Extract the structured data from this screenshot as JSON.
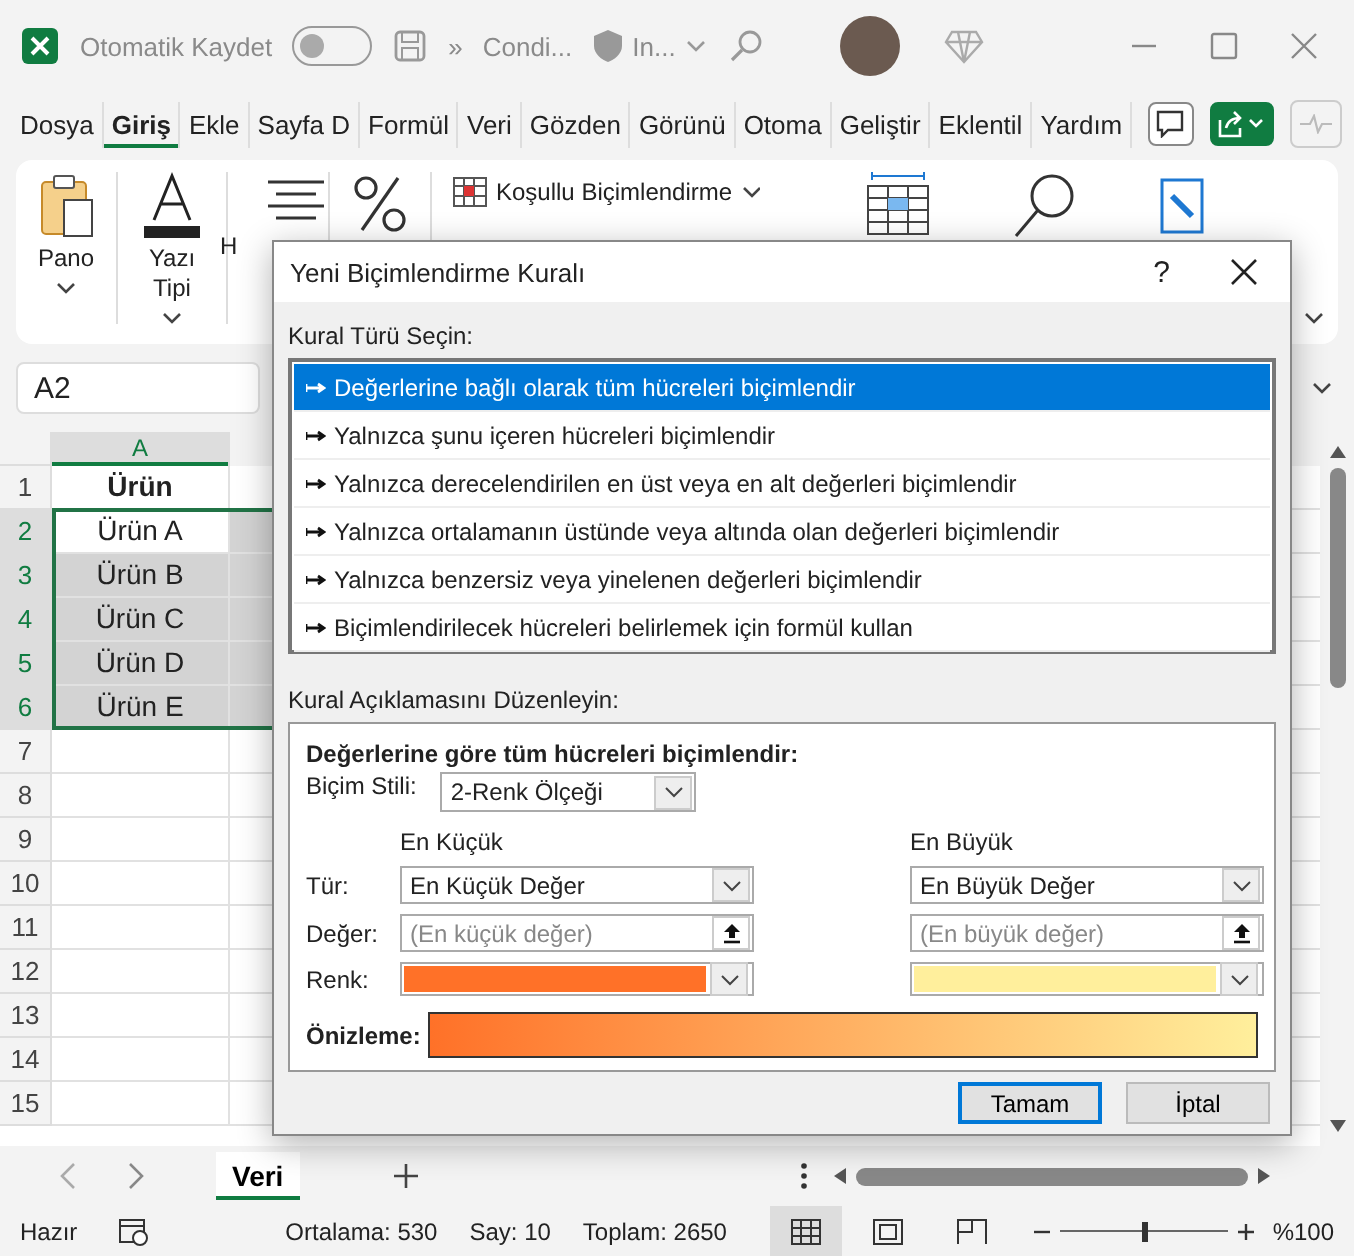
{
  "title_bar": {
    "autosave_label": "Otomatik Kaydet",
    "autosave_on": false,
    "more": "»",
    "document": "Condi...",
    "sensitivity": "In..."
  },
  "menu_tabs": [
    {
      "label": "Dosya",
      "selected": false
    },
    {
      "label": "Giriş",
      "selected": true
    },
    {
      "label": "Ekle",
      "selected": false
    },
    {
      "label": "Sayfa D",
      "selected": false
    },
    {
      "label": "Formül",
      "selected": false
    },
    {
      "label": "Veri",
      "selected": false
    },
    {
      "label": "Gözden",
      "selected": false
    },
    {
      "label": "Görünü",
      "selected": false
    },
    {
      "label": "Otoma",
      "selected": false
    },
    {
      "label": "Geliştir",
      "selected": false
    },
    {
      "label": "Eklentil",
      "selected": false
    },
    {
      "label": "Yardım",
      "selected": false
    }
  ],
  "ribbon": {
    "groups": [
      {
        "kind": "clipboard",
        "label": "Pano"
      },
      {
        "kind": "font",
        "label": "Yazı Tipi"
      },
      {
        "kind": "alignment",
        "label": "H"
      },
      {
        "kind": "number"
      }
    ],
    "conditional_formatting": "Koşullu Biçimlendirme"
  },
  "name_box": "A2",
  "sheet": {
    "columns": [
      "A"
    ],
    "rows": [
      {
        "header": "1",
        "value": "Ürün",
        "kind": "header",
        "selected": false,
        "active": false
      },
      {
        "header": "2",
        "value": "Ürün A",
        "kind": "data",
        "selected": true,
        "active": true
      },
      {
        "header": "3",
        "value": "Ürün B",
        "kind": "data",
        "selected": true,
        "active": false
      },
      {
        "header": "4",
        "value": "Ürün C",
        "kind": "data",
        "selected": true,
        "active": false
      },
      {
        "header": "5",
        "value": "Ürün D",
        "kind": "data",
        "selected": true,
        "active": false
      },
      {
        "header": "6",
        "value": "Ürün E",
        "kind": "data",
        "selected": true,
        "active": false
      },
      {
        "header": "7",
        "selected": false,
        "active": false
      },
      {
        "header": "8",
        "selected": false,
        "active": false
      },
      {
        "header": "9",
        "selected": false,
        "active": false
      },
      {
        "header": "10",
        "selected": false,
        "active": false
      },
      {
        "header": "11",
        "selected": false,
        "active": false
      },
      {
        "header": "12",
        "selected": false,
        "active": false
      },
      {
        "header": "13",
        "selected": false,
        "active": false
      },
      {
        "header": "14",
        "selected": false,
        "active": false
      },
      {
        "header": "15",
        "selected": false,
        "active": false
      }
    ]
  },
  "sheet_tabs": [
    {
      "label": "Veri",
      "selected": true
    }
  ],
  "status_bar": {
    "mode": "Hazır",
    "average": "Ortalama: 530",
    "count": "Say: 10",
    "sum": "Toplam: 2650",
    "zoom": "%100",
    "zoom_slider": {
      "level": 0.5
    },
    "views": [
      {
        "kind": "normal",
        "selected": true
      },
      {
        "kind": "page_layout",
        "selected": false
      },
      {
        "kind": "page_break",
        "selected": false
      }
    ]
  },
  "dialog": {
    "title": "Yeni Biçimlendirme Kuralı",
    "help": "?",
    "rule_type_label": "Kural Türü Seçin:",
    "rules": [
      {
        "label": "Değerlerine bağlı olarak tüm hücreleri biçimlendir",
        "selected": true
      },
      {
        "label": "Yalnızca şunu içeren hücreleri biçimlendir",
        "selected": false
      },
      {
        "label": "Yalnızca derecelendirilen en üst veya en alt değerleri biçimlendir",
        "selected": false
      },
      {
        "label": "Yalnızca ortalamanın üstünde veya altında olan değerleri biçimlendir",
        "selected": false
      },
      {
        "label": "Yalnızca benzersiz veya yinelenen değerleri biçimlendir",
        "selected": false
      },
      {
        "label": "Biçimlendirilecek hücreleri belirlemek için formül kullan",
        "selected": false
      }
    ],
    "description_label": "Kural Açıklamasını Düzenleyin:",
    "heading": "Değerlerine göre tüm hücreleri biçimlendir:",
    "style_label": "Biçim Stili:",
    "style_value": "2-Renk Ölçeği",
    "row_labels": [
      "Tür:",
      "Değer:",
      "Renk:"
    ],
    "ends": [
      {
        "header": "En Küçük",
        "type": "En Küçük Değer",
        "value_placeholder": "(En küçük değer)",
        "color": "#ff7128"
      },
      {
        "header": "En Büyük",
        "type": "En Büyük Değer",
        "value_placeholder": "(En büyük değer)",
        "color": "#ffef9c"
      }
    ],
    "preview_label": "Önizleme:",
    "buttons": [
      {
        "label": "Tamam",
        "default": true
      },
      {
        "label": "İptal",
        "default": false
      }
    ]
  }
}
